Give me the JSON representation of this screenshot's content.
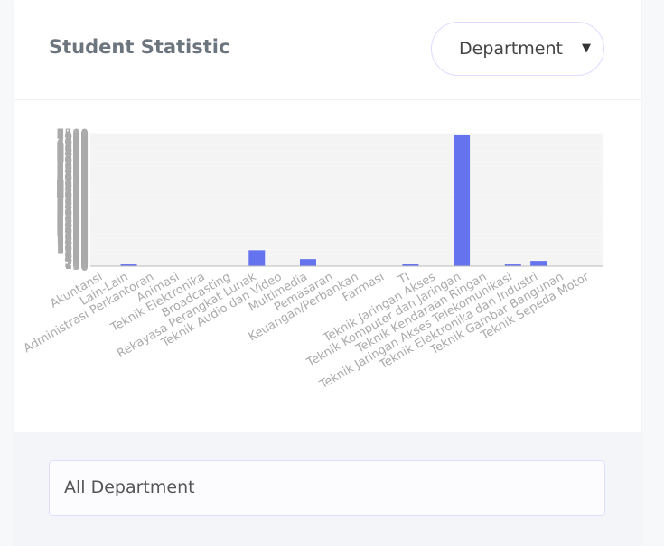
{
  "card": {
    "title": "Student Statistic",
    "filter": {
      "selected": "Department"
    }
  },
  "footer": {
    "department_filter": "All Department"
  },
  "colors": {
    "bar": "#6673ee",
    "grid": "#eeeeee",
    "axis_text": "#aaaaaa",
    "title_text": "#6c757d"
  },
  "chart_data": {
    "type": "bar",
    "title": "",
    "xlabel": "",
    "ylabel": "",
    "ylim": [
      0,
      7500
    ],
    "yticks": [
      0,
      50,
      100,
      150,
      200,
      250,
      300,
      350,
      400,
      450,
      500,
      550,
      600,
      650,
      700,
      750,
      800,
      850,
      900,
      950,
      1000,
      1050,
      1100,
      1150,
      1200,
      1250,
      1300,
      1350,
      1400,
      1450,
      1500,
      1550,
      1600,
      1650,
      1700,
      1750,
      1800,
      1850,
      1900,
      1950,
      2000,
      2050,
      2100,
      2150,
      2200,
      2250,
      2300,
      2350,
      2400,
      2450,
      2500,
      2550,
      2600,
      2650,
      2700,
      2750,
      2800,
      2850,
      2900,
      2950,
      3000,
      3050,
      3100,
      3150,
      3200,
      3250,
      3300,
      3350,
      3400,
      3450,
      3500,
      3550,
      3600,
      3650,
      3700,
      3750,
      3800,
      3850,
      3900,
      3950,
      4000,
      4050,
      4100,
      4150,
      4200,
      4250,
      4300,
      4350,
      4400,
      4450,
      4500,
      4550,
      4600,
      4650,
      4700,
      4750,
      4800,
      4850,
      4900,
      4950,
      5000,
      5050,
      5100,
      5150,
      5200,
      5250,
      5300,
      5350,
      5400,
      5450,
      5500,
      5550,
      5600,
      5650,
      5700,
      5750,
      5800,
      5850,
      5900,
      5950,
      6000,
      6050,
      6100,
      6150,
      6200,
      6250,
      6300,
      6350,
      6400,
      6450,
      6500,
      6550,
      6600,
      6650,
      6700,
      6750,
      6800,
      6850,
      6900,
      6950,
      7000,
      7050,
      7100,
      7150,
      7200,
      7250,
      7300,
      7350,
      7400,
      7450,
      7500
    ],
    "categories": [
      "Akuntansi",
      "Lain-Lain",
      "Administrasi Perkantoran",
      "Animasi",
      "Teknik Elektronika",
      "Broadcasting",
      "Rekayasa Perangkat Lunak",
      "Teknik Audio dan Video",
      "Multimedia",
      "Pemasaran",
      "Keuangan/Perbankan",
      "Farmasi",
      "TI",
      "Teknik Jaringan Akses",
      "Teknik Komputer dan Jaringan",
      "Teknik Kendaraan Ringan",
      "Teknik Jaringan Akses Telekomunikasi",
      "Teknik Elektronika dan Industri",
      "Teknik Gambar Bangunan",
      "Teknik Sepeda Motor"
    ],
    "values": [
      0,
      100,
      0,
      0,
      0,
      0,
      900,
      0,
      400,
      0,
      0,
      0,
      150,
      0,
      7400,
      0,
      100,
      300,
      0,
      0
    ]
  }
}
